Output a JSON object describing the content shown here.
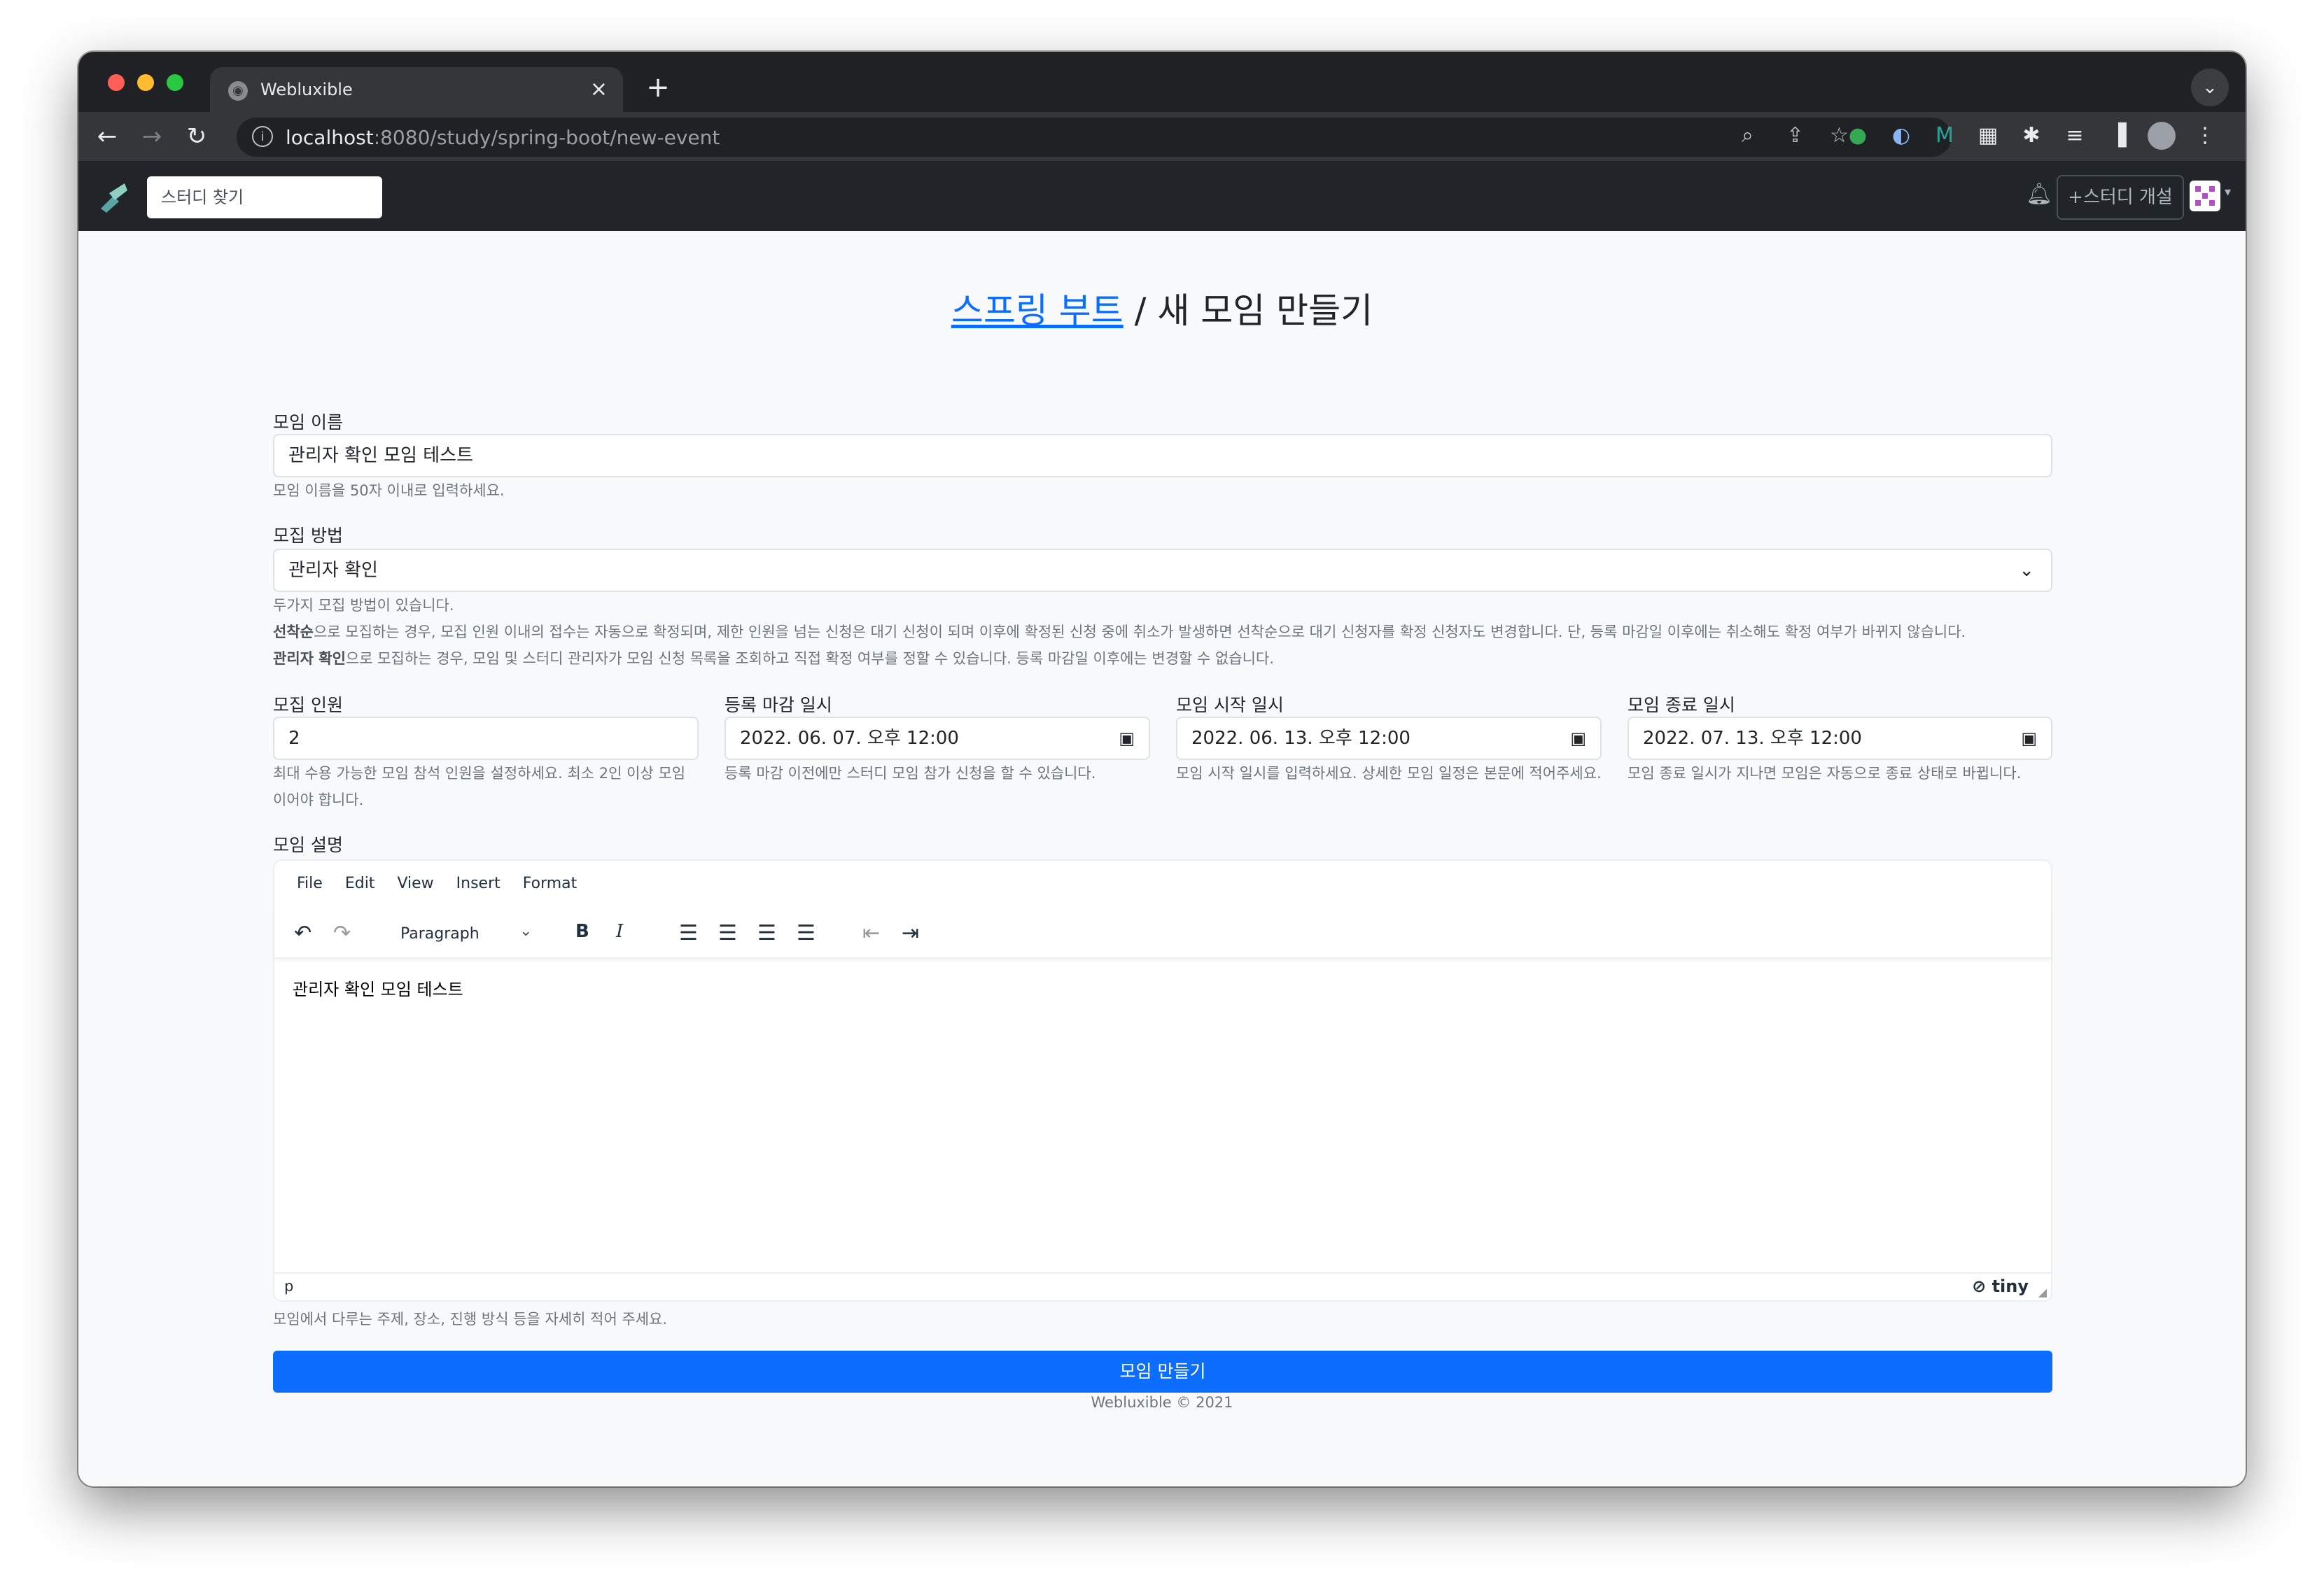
{
  "browser": {
    "tab_title": "Webluxible",
    "url_host": "localhost",
    "url_path": ":8080/study/spring-boot/new-event"
  },
  "navbar": {
    "search_placeholder": "스터디 찾기",
    "new_study_label": "스터디 개설"
  },
  "heading": {
    "study_link": "스프링 부트",
    "separator": " / ",
    "title": "새 모임 만들기"
  },
  "form": {
    "title_label": "모임 이름",
    "title_value": "관리자 확인 모임 테스트",
    "title_help": "모임 이름을 50자 이내로 입력하세요.",
    "type_label": "모집 방법",
    "type_value": "관리자 확인",
    "type_help_1": "두가지 모집 방법이 있습니다.",
    "type_help_2_bold": "선착순",
    "type_help_2": "으로 모집하는 경우, 모집 인원 이내의 접수는 자동으로 확정되며, 제한 인원을 넘는 신청은 대기 신청이 되며 이후에 확정된 신청 중에 취소가 발생하면 선착순으로 대기 신청자를 확정 신청자도 변경합니다. 단, 등록 마감일 이후에는 취소해도 확정 여부가 바뀌지 않습니다.",
    "type_help_3_bold": "관리자 확인",
    "type_help_3": "으로 모집하는 경우, 모임 및 스터디 관리자가 모임 신청 목록을 조회하고 직접 확정 여부를 정할 수 있습니다. 등록 마감일 이후에는 변경할 수 없습니다.",
    "limit_label": "모집 인원",
    "limit_value": "2",
    "limit_help": "최대 수용 가능한 모임 참석 인원을 설정하세요. 최소 2인 이상 모임이어야 합니다.",
    "enroll_label": "등록 마감 일시",
    "enroll_value": "2022. 06. 07. 오후 12:00",
    "enroll_help": "등록 마감 이전에만 스터디 모임 참가 신청을 할 수 있습니다.",
    "start_label": "모임 시작 일시",
    "start_value": "2022. 06. 13. 오후 12:00",
    "start_help": "모임 시작 일시를 입력하세요. 상세한 모임 일정은 본문에 적어주세요.",
    "end_label": "모임 종료 일시",
    "end_value": "2022. 07. 13. 오후 12:00",
    "end_help": "모임 종료 일시가 지나면 모임은 자동으로 종료 상태로 바뀝니다.",
    "desc_label": "모임 설명",
    "desc_help": "모임에서 다루는 주제, 장소, 진행 방식 등을 자세히 적어 주세요.",
    "submit_label": "모임 만들기"
  },
  "editor": {
    "menu": [
      "File",
      "Edit",
      "View",
      "Insert",
      "Format"
    ],
    "block_format": "Paragraph",
    "content": "관리자 확인 모임 테스트",
    "status_path": "p",
    "brand": "tiny"
  },
  "footer": "Webluxible © 2021",
  "colors": {
    "primary": "#0d6efd",
    "navbar": "#212529",
    "chrome_dark": "#202124",
    "chrome_toolbar": "#35363a"
  },
  "icons": {
    "editor_toolbar": [
      "undo-icon",
      "redo-icon",
      "bold-icon",
      "italic-icon",
      "align-left-icon",
      "align-center-icon",
      "align-right-icon",
      "align-justify-icon",
      "outdent-icon",
      "indent-icon"
    ]
  }
}
